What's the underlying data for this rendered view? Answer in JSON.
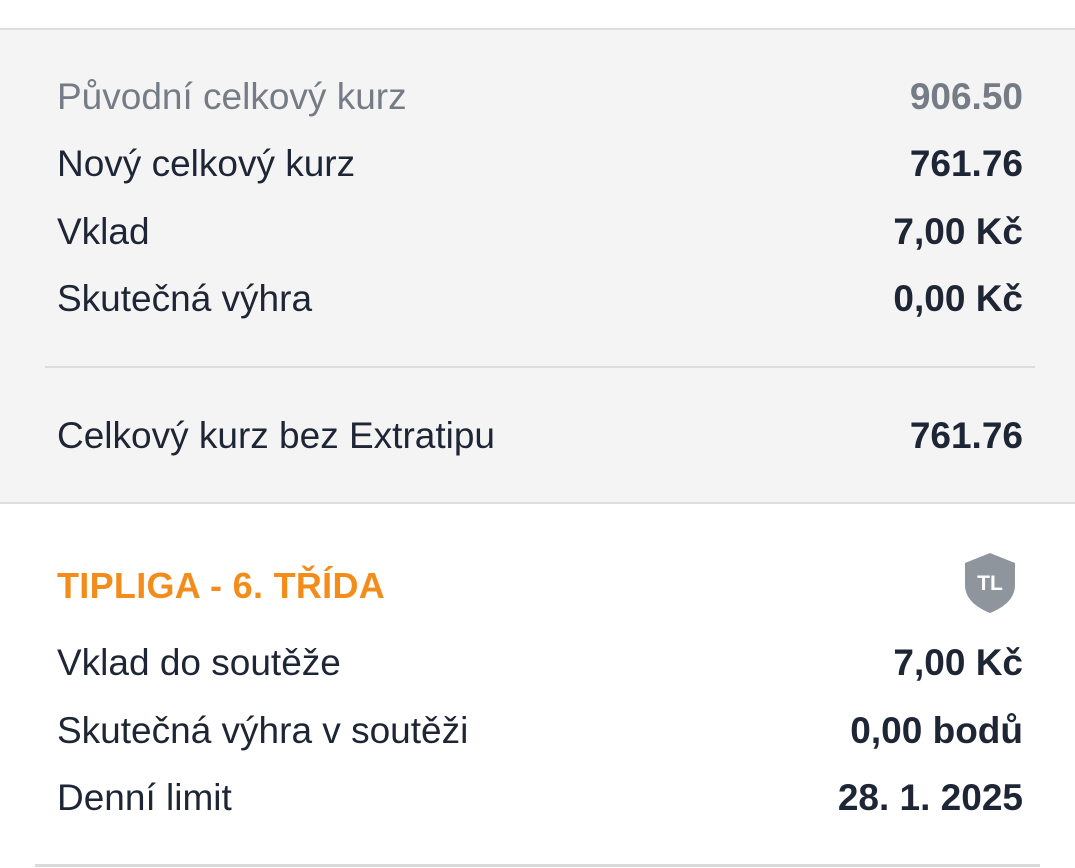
{
  "summary": {
    "original_odds": {
      "label": "Původní celkový kurz",
      "value": "906.50"
    },
    "new_odds": {
      "label": "Nový celkový kurz",
      "value": "761.76"
    },
    "stake": {
      "label": "Vklad",
      "value": "7,00 Kč"
    },
    "actual_win": {
      "label": "Skutečná výhra",
      "value": "0,00 Kč"
    },
    "odds_without_extratip": {
      "label": "Celkový kurz bez Extratipu",
      "value": "761.76"
    }
  },
  "league": {
    "title": "TIPLIGA - 6. TŘÍDA",
    "badge_text": "TL",
    "badge_icon": "shield-icon",
    "rows": [
      {
        "label": "Vklad do soutěže",
        "value": "7,00 Kč"
      },
      {
        "label": "Skutečná výhra v soutěži",
        "value": "0,00 bodů"
      },
      {
        "label": "Denní limit",
        "value": "28. 1. 2025"
      }
    ]
  },
  "colors": {
    "accent": "#f28c1b",
    "text": "#1e2535",
    "muted": "#757c86",
    "panel": "#f4f4f4",
    "badge": "#8f959c"
  }
}
